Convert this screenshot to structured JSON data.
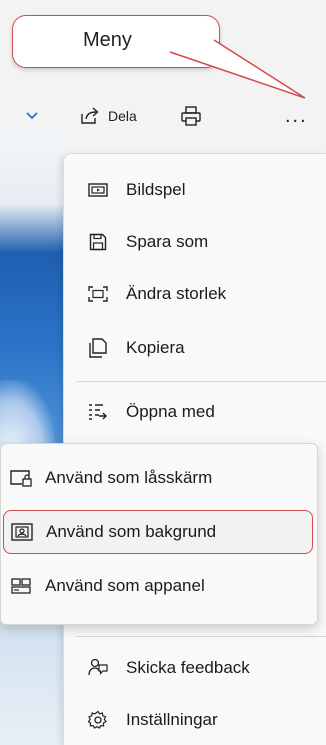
{
  "callout": {
    "text": "Meny"
  },
  "toolbar": {
    "share_label": "Dela",
    "more_label": "..."
  },
  "menu": {
    "items": [
      {
        "label": "Bildspel",
        "icon": "slideshow-icon"
      },
      {
        "label": "Spara som",
        "icon": "save-icon"
      },
      {
        "label": "Ändra storlek",
        "icon": "resize-icon"
      },
      {
        "label": "Kopiera",
        "icon": "copy-icon"
      },
      {
        "label": "Öppna med",
        "icon": "open-with-icon"
      },
      {
        "label": "Skicka feedback",
        "icon": "feedback-icon"
      },
      {
        "label": "Inställningar",
        "icon": "settings-icon"
      }
    ]
  },
  "submenu": {
    "items": [
      {
        "label": "Använd som låsskärm",
        "icon": "lock-screen-icon"
      },
      {
        "label": "Använd som bakgrund",
        "icon": "background-icon"
      },
      {
        "label": "Använd som appanel",
        "icon": "app-panel-icon"
      }
    ]
  },
  "colors": {
    "highlight_border": "#d24b4b",
    "accent": "#1a6fd0"
  }
}
